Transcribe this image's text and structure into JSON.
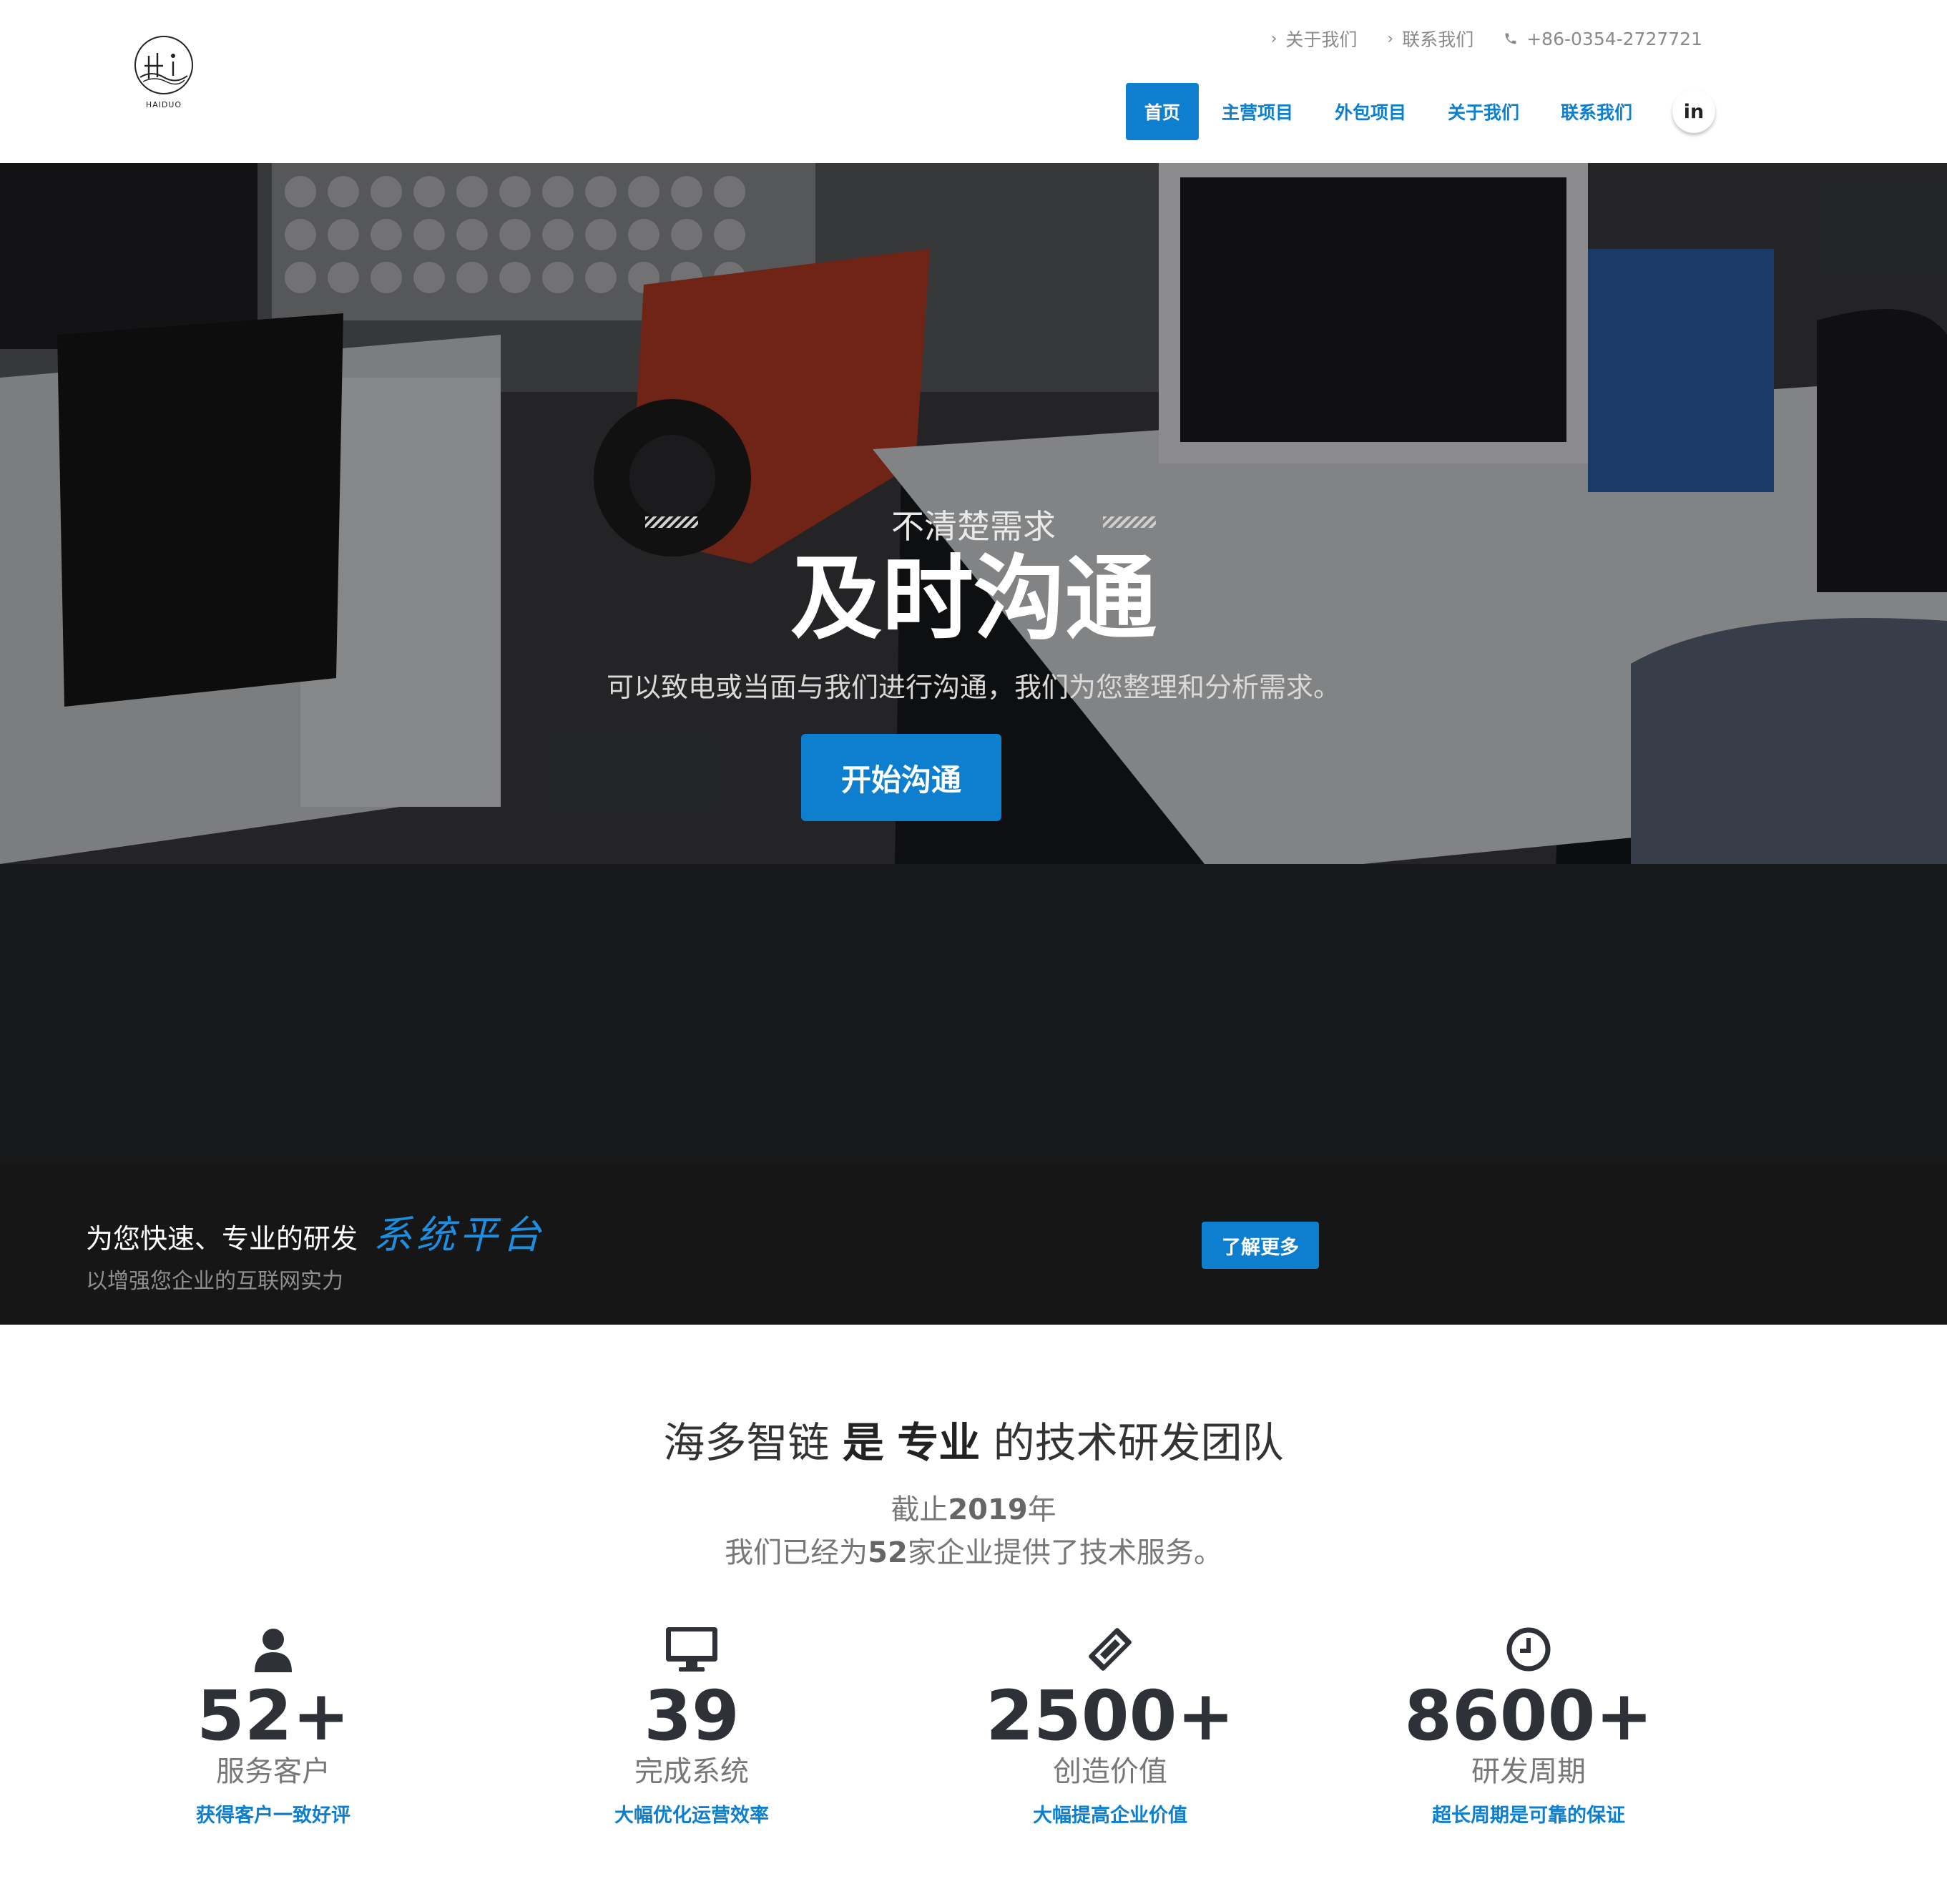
{
  "brand": {
    "logo_text": "HAIDUO"
  },
  "topbar": {
    "links": [
      "关于我们",
      "联系我们"
    ],
    "phone": "+86-0354-2727721"
  },
  "nav": {
    "items": [
      "首页",
      "主营项目",
      "外包项目",
      "关于我们",
      "联系我们"
    ],
    "active_index": 0,
    "social": "in"
  },
  "hero": {
    "kicker": "不清楚需求",
    "title": "及时沟通",
    "subtitle": "可以致电或当面与我们进行沟通，我们为您整理和分析需求。",
    "button": "开始沟通"
  },
  "callout": {
    "line1_prefix": "为您快速、专业的研发",
    "line1_accent": "系统平台",
    "line2": "以增强您企业的互联网实力",
    "button": "了解更多"
  },
  "about": {
    "title_part1": "海多智链",
    "title_bold1": "是",
    "title_bold2": "专业",
    "title_part2": "的技术研发团队",
    "line1_prefix": "截止",
    "line1_year": "2019",
    "line1_suffix": "年",
    "line2_prefix": "我们已经为",
    "line2_count": "52",
    "line2_suffix": "家企业提供了技术服务。"
  },
  "stats": [
    {
      "icon": "user-icon",
      "value": "52+",
      "label": "服务客户",
      "sub": "获得客户一致好评"
    },
    {
      "icon": "monitor-icon",
      "value": "39",
      "label": "完成系统",
      "sub": "大幅优化运营效率"
    },
    {
      "icon": "ticket-icon",
      "value": "2500+",
      "label": "创造价值",
      "sub": "大幅提高企业价值"
    },
    {
      "icon": "clock-icon",
      "value": "8600+",
      "label": "研发周期",
      "sub": "超长周期是可靠的保证"
    }
  ],
  "colors": {
    "accent": "#0e7fce",
    "dark_band": "#161616",
    "stat_value": "#2e3238"
  }
}
